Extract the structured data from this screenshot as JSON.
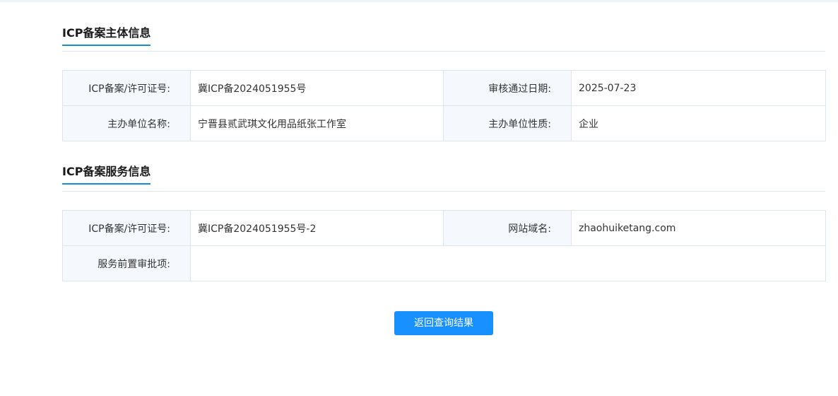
{
  "subject_section": {
    "title": "ICP备案主体信息",
    "rows": [
      {
        "label1": "ICP备案/许可证号:",
        "value1": "冀ICP备2024051955号",
        "label2": "审核通过日期:",
        "value2": "2025-07-23"
      },
      {
        "label1": "主办单位名称:",
        "value1": "宁晋县贰武琪文化用品纸张工作室",
        "label2": "主办单位性质:",
        "value2": "企业"
      }
    ]
  },
  "service_section": {
    "title": "ICP备案服务信息",
    "rows": [
      {
        "label1": "ICP备案/许可证号:",
        "value1": "冀ICP备2024051955号-2",
        "label2": "网站域名:",
        "value2": "zhaohuiketang.com"
      },
      {
        "label1": "服务前置审批项:",
        "value1": ""
      }
    ]
  },
  "back_button_label": "返回查询结果"
}
